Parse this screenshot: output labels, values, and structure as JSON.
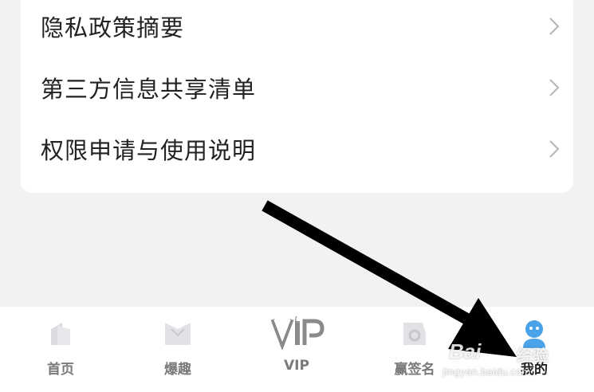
{
  "menu": {
    "items": [
      {
        "label": "隐私政策摘要"
      },
      {
        "label": "第三方信息共享清单"
      },
      {
        "label": "权限申请与使用说明"
      }
    ]
  },
  "tabbar": {
    "tabs": [
      {
        "label": "首页",
        "icon": "home-icon"
      },
      {
        "label": "爆趣",
        "icon": "fun-icon"
      },
      {
        "label": "VIP",
        "icon": "vip-logo"
      },
      {
        "label": "赢签名",
        "icon": "autograph-icon"
      },
      {
        "label": "我的",
        "icon": "profile-icon",
        "active": true
      }
    ]
  },
  "watermark": {
    "brand": "Bai",
    "brand_suffix": "经验",
    "url": "jingyan.baidu.com"
  },
  "colors": {
    "background": "#f2f2f4",
    "card": "#ffffff",
    "active_tab": "#4aa3e8",
    "arrow": "#000000"
  }
}
